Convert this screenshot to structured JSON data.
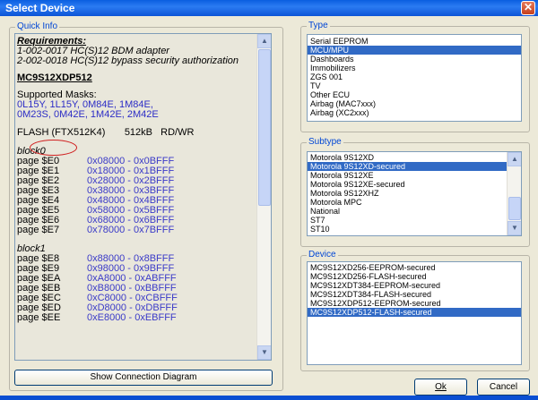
{
  "window": {
    "title": "Select Device",
    "close_glyph": "✕"
  },
  "quick_info": {
    "label": "Quick Info",
    "requirements_title": "Requirements:",
    "requirements": [
      "1-002-0017  HC(S)12 BDM adapter",
      "2-002-0018  HC(S)12 bypass security authorization"
    ],
    "device_name": "MC9S12XDP512",
    "masks_label": "Supported Masks:",
    "masks": [
      "0L15Y, 1L15Y, 0M84E, 1M84E,",
      "0M23S, 0M42E, 1M42E, 2M42E"
    ],
    "flash_line": "FLASH (FTX512K4)       512kB   RD/WR",
    "blocks": [
      {
        "label": "block0",
        "pages": [
          {
            "name": "page $E0",
            "range": "0x08000 - 0x0BFFF"
          },
          {
            "name": "page $E1",
            "range": "0x18000 - 0x1BFFF"
          },
          {
            "name": "page $E2",
            "range": "0x28000 - 0x2BFFF"
          },
          {
            "name": "page $E3",
            "range": "0x38000 - 0x3BFFF"
          },
          {
            "name": "page $E4",
            "range": "0x48000 - 0x4BFFF"
          },
          {
            "name": "page $E5",
            "range": "0x58000 - 0x5BFFF"
          },
          {
            "name": "page $E6",
            "range": "0x68000 - 0x6BFFF"
          },
          {
            "name": "page $E7",
            "range": "0x78000 - 0x7BFFF"
          }
        ]
      },
      {
        "label": "block1",
        "pages": [
          {
            "name": "page $E8",
            "range": "0x88000 - 0x8BFFF"
          },
          {
            "name": "page $E9",
            "range": "0x98000 - 0x9BFFF"
          },
          {
            "name": "page $EA",
            "range": "0xA8000 - 0xABFFF"
          },
          {
            "name": "page $EB",
            "range": "0xB8000 - 0xBBFFF"
          },
          {
            "name": "page $EC",
            "range": "0xC8000 - 0xCBFFF"
          },
          {
            "name": "page $ED",
            "range": "0xD8000 - 0xDBFFF"
          },
          {
            "name": "page $EE",
            "range": "0xE8000 - 0xEBFFF"
          }
        ]
      }
    ]
  },
  "type": {
    "label": "Type",
    "items": [
      "Serial EEPROM",
      "MCU/MPU",
      "Dashboards",
      "Immobilizers",
      "ZGS 001",
      "TV",
      "Other ECU",
      "Airbag (MAC7xxx)",
      "Airbag (XC2xxx)"
    ],
    "selected": 1
  },
  "subtype": {
    "label": "Subtype",
    "items": [
      "Motorola 9S12XD",
      "Motorola 9S12XD-secured",
      "Motorola 9S12XE",
      "Motorola 9S12XE-secured",
      "Motorola 9S12XHZ",
      "Motorola MPC",
      "National",
      "ST7",
      "ST10"
    ],
    "selected": 1
  },
  "device": {
    "label": "Device",
    "items": [
      "MC9S12XD256-EEPROM-secured",
      "MC9S12XD256-FLASH-secured",
      "MC9S12XDT384-EEPROM-secured",
      "MC9S12XDT384-FLASH-secured",
      "MC9S12XDP512-EEPROM-secured",
      "MC9S12XDP512-FLASH-secured"
    ],
    "selected": 5
  },
  "buttons": {
    "show_diagram": "Show Connection Diagram",
    "ok": "Ok",
    "cancel": "Cancel"
  },
  "icons": {
    "scroll_up": "scroll-up-arrow-icon",
    "scroll_down": "scroll-down-arrow-icon"
  }
}
